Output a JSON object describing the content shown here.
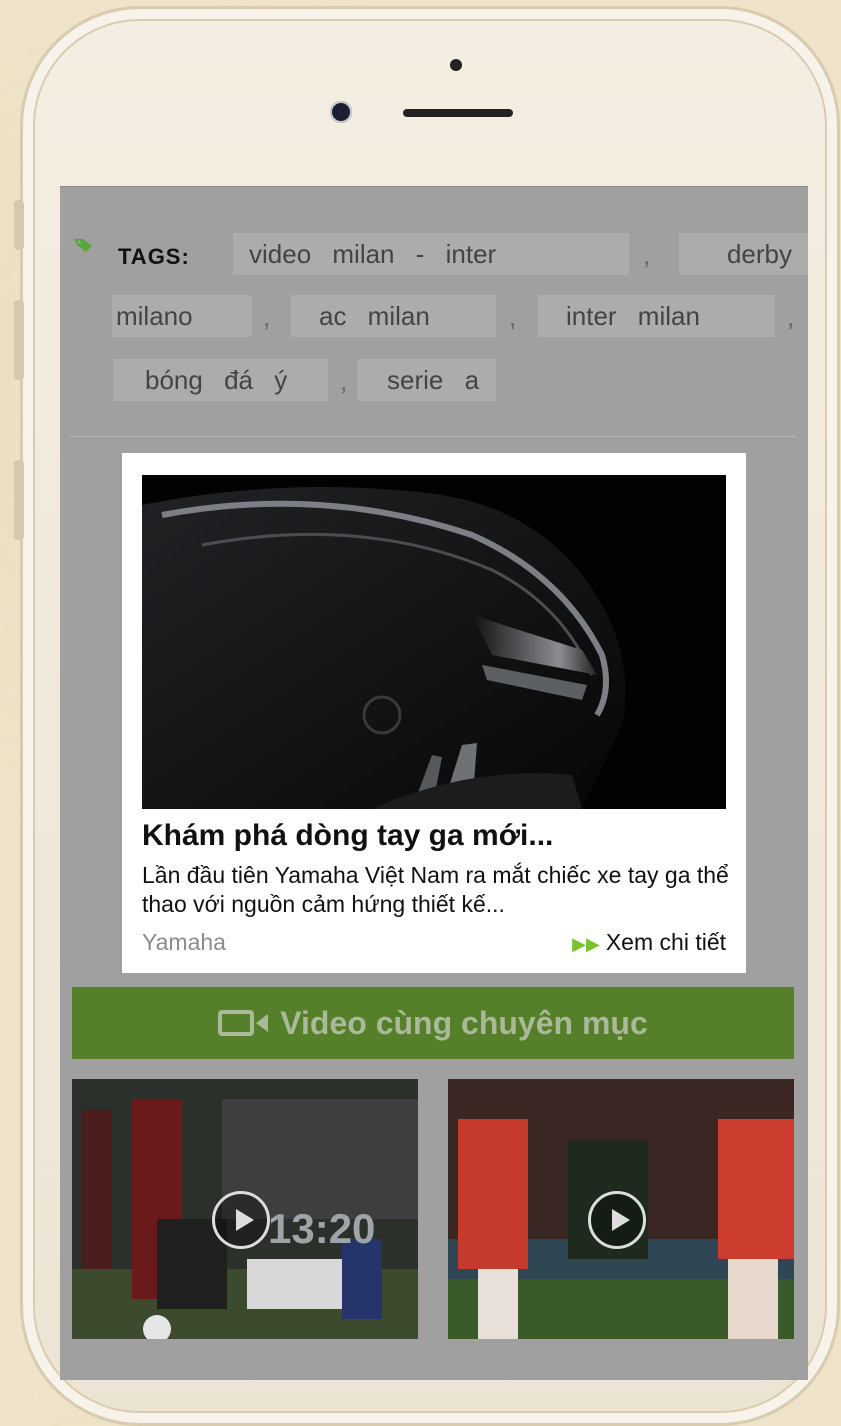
{
  "tags": {
    "label": "TAGS:",
    "items": [
      "video milan - inter",
      "derby",
      "milano",
      "ac milan",
      "inter milan",
      "bóng đá ý",
      "serie a"
    ],
    "separator": ","
  },
  "ad": {
    "title": "Khám phá dòng tay ga mới...",
    "description": "Lần đầu tiên Yamaha Việt Nam ra mắt chiếc xe tay ga thể thao với nguồn cảm hứng thiết kế...",
    "brand": "Yamaha",
    "more_label": "Xem chi tiết"
  },
  "video_section": {
    "title": "Video cùng chuyên mục",
    "thumb1_overlay": "13:20"
  },
  "colors": {
    "section_green": "#557f28",
    "accent_green": "#7cc22f",
    "screen_gray": "#a0a0a0"
  }
}
